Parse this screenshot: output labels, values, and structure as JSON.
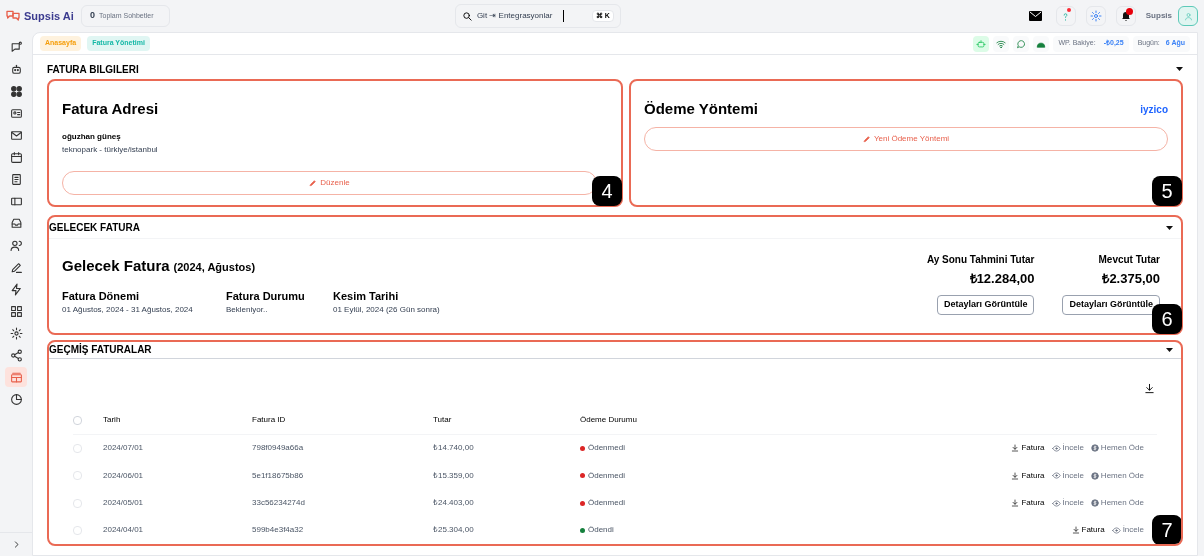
{
  "brand": {
    "name": "Supsis Ai"
  },
  "chat_counter": {
    "count": "0",
    "label": "Toplam Sohbetler"
  },
  "search": {
    "value": "Git ⇥ Entegrasyonlar",
    "shortcut": "⌘ K"
  },
  "user": {
    "name": "Supsis"
  },
  "sidebar": {
    "items": [
      {
        "selected": false
      },
      {
        "selected": false
      },
      {
        "selected": false
      },
      {
        "selected": false
      },
      {
        "selected": false
      },
      {
        "selected": false
      },
      {
        "selected": false
      },
      {
        "selected": false
      },
      {
        "selected": false
      },
      {
        "selected": false
      },
      {
        "selected": false
      },
      {
        "selected": false
      },
      {
        "selected": false
      },
      {
        "selected": false
      },
      {
        "selected": false
      },
      {
        "selected": true
      },
      {
        "selected": false
      }
    ]
  },
  "breadcrumbs": [
    {
      "label": "Anasayfa",
      "color": "#f59e0b"
    },
    {
      "label": "Fatura Yönetimi",
      "color": "#14b8a6"
    }
  ],
  "status": {
    "balance_label": "WP. Bakiye:",
    "balance": "-₺0,25",
    "today_label": "Bugün:",
    "today": "6 Ağu"
  },
  "billing_info": {
    "heading": "FATURA BILGILERI",
    "address": {
      "title": "Fatura Adresi",
      "name": "oğuzhan güneş",
      "address": "teknopark - türkiye/istanbul",
      "button": "Düzenle",
      "callout": "4"
    },
    "payment": {
      "title": "Ödeme Yöntemi",
      "provider": "iyzico",
      "button": "Yeni Ödeme Yöntemi",
      "callout": "5"
    }
  },
  "upcoming": {
    "heading": "GELECEK FATURA",
    "title": "Gelecek Fatura",
    "subtitle": "(2024, Ağustos)",
    "callout": "6",
    "fields": [
      {
        "label": "Fatura Dönemi",
        "value": "01 Ağustos, 2024 - 31 Ağustos, 2024"
      },
      {
        "label": "Fatura Durumu",
        "value": "Bekleniyor.."
      },
      {
        "label": "Kesim Tarihi",
        "value": "01 Eylül, 2024 (26 Gün sonra)"
      }
    ],
    "totals": [
      {
        "label": "Ay Sonu Tahmini Tutar",
        "amount": "₺12.284,00",
        "button": "Detayları Görüntüle"
      },
      {
        "label": "Mevcut Tutar",
        "amount": "₺2.375,00",
        "button": "Detayları Görüntüle"
      }
    ]
  },
  "past": {
    "heading": "GEÇMİŞ FATURALAR",
    "callout": "7",
    "columns": [
      "Tarih",
      "Fatura ID",
      "Tutar",
      "Ödeme Durumu"
    ],
    "header_checked": false,
    "rows": [
      {
        "checked": false,
        "date": "2024/07/01",
        "id": "798f0949a66a",
        "amount": "₺14.740,00",
        "status": "Ödenmedi",
        "color": "#dc2626",
        "actions": [
          {
            "kind": "download",
            "label": "Fatura"
          },
          {
            "kind": "view",
            "label": "İncele"
          },
          {
            "kind": "pay",
            "label": "Hemen Öde"
          }
        ]
      },
      {
        "checked": false,
        "date": "2024/06/01",
        "id": "5e1f18675b86",
        "amount": "₺15.359,00",
        "status": "Ödenmedi",
        "color": "#dc2626",
        "actions": [
          {
            "kind": "download",
            "label": "Fatura"
          },
          {
            "kind": "view",
            "label": "İncele"
          },
          {
            "kind": "pay",
            "label": "Hemen Öde"
          }
        ]
      },
      {
        "checked": false,
        "date": "2024/05/01",
        "id": "33c56234274d",
        "amount": "₺24.403,00",
        "status": "Ödenmedi",
        "color": "#dc2626",
        "actions": [
          {
            "kind": "download",
            "label": "Fatura"
          },
          {
            "kind": "view",
            "label": "İncele"
          },
          {
            "kind": "pay",
            "label": "Hemen Öde"
          }
        ]
      },
      {
        "checked": false,
        "date": "2024/04/01",
        "id": "599b4e3f4a32",
        "amount": "₺25.304,00",
        "status": "Ödendi",
        "color": "#15803d",
        "actions": [
          {
            "kind": "download",
            "label": "Fatura"
          },
          {
            "kind": "view",
            "label": "İncele"
          }
        ]
      }
    ]
  }
}
